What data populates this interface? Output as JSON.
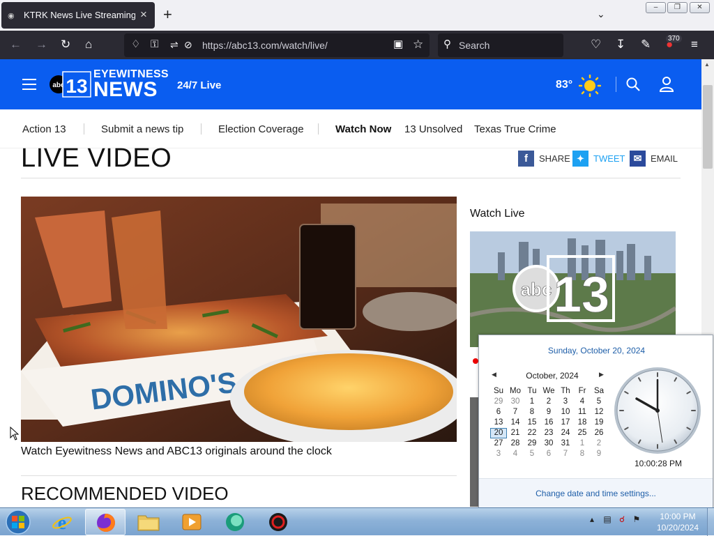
{
  "browser": {
    "tab_title": "KTRK News Live Streaming Video",
    "url": "https://abc13.com/watch/live/",
    "search_placeholder": "Search",
    "extension_badge": "370"
  },
  "site": {
    "logo_number": "13",
    "logo_abc": "abc",
    "logo_eyewitness": "EYEWITNESS",
    "logo_news": "NEWS",
    "live_label": "24/7 Live",
    "temperature": "83°",
    "nav": [
      "Action 13",
      "Submit a news tip",
      "Election Coverage",
      "Watch Now",
      "13 Unsolved",
      "Texas True Crime"
    ],
    "page_title": "LIVE VIDEO",
    "share_label": "SHARE",
    "tweet_label": "TWEET",
    "email_label": "EMAIL",
    "video_caption": "Watch Eyewitness News and ABC13 originals around the clock",
    "video_overlay_text": "DOMINO'S",
    "recommended_title": "RECOMMENDED VIDEO",
    "watch_live_label": "Watch Live",
    "brand_color": "#0a5df0"
  },
  "calendar": {
    "full_date": "Sunday, October 20, 2024",
    "month": "October, 2024",
    "weekdays": [
      "Su",
      "Mo",
      "Tu",
      "We",
      "Th",
      "Fr",
      "Sa"
    ],
    "weeks": [
      [
        "29",
        "30",
        "1",
        "2",
        "3",
        "4",
        "5"
      ],
      [
        "6",
        "7",
        "8",
        "9",
        "10",
        "11",
        "12"
      ],
      [
        "13",
        "14",
        "15",
        "16",
        "17",
        "18",
        "19"
      ],
      [
        "20",
        "21",
        "22",
        "23",
        "24",
        "25",
        "26"
      ],
      [
        "27",
        "28",
        "29",
        "30",
        "31",
        "1",
        "2"
      ],
      [
        "3",
        "4",
        "5",
        "6",
        "7",
        "8",
        "9"
      ]
    ],
    "today": "20",
    "time": "10:00:28 PM",
    "settings_link": "Change date and time settings..."
  },
  "taskbar": {
    "time": "10:00 PM",
    "date": "10/20/2024"
  }
}
